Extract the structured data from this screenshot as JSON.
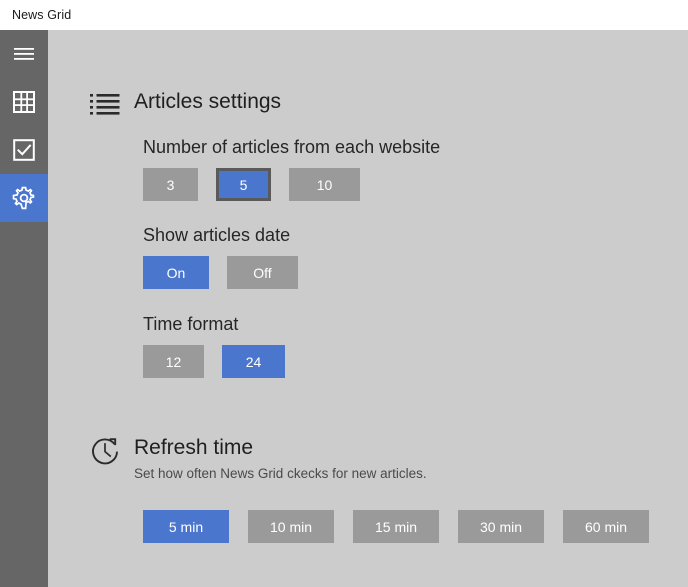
{
  "window": {
    "title": "News Grid"
  },
  "sidebar": {
    "items": [
      {
        "icon": "hamburger-menu-icon",
        "name": "menu",
        "selected": false
      },
      {
        "icon": "grid-icon",
        "name": "grid",
        "selected": false
      },
      {
        "icon": "checkbox-check-icon",
        "name": "tasks",
        "selected": false
      },
      {
        "icon": "gear-icon",
        "name": "settings",
        "selected": true
      }
    ]
  },
  "articles_settings": {
    "icon": "list-icon",
    "title": "Articles settings",
    "number_of_articles": {
      "label": "Number of articles from each website",
      "options": [
        "3",
        "5",
        "10"
      ],
      "selected": "5",
      "focused": "5"
    },
    "show_articles_date": {
      "label": "Show articles date",
      "options": [
        "On",
        "Off"
      ],
      "selected": "On"
    },
    "time_format": {
      "label": "Time format",
      "options": [
        "12",
        "24"
      ],
      "selected": "24"
    }
  },
  "refresh_time": {
    "icon": "clock-refresh-icon",
    "title": "Refresh time",
    "subtitle": "Set how often News Grid ckecks for new articles.",
    "options": [
      "5 min",
      "10 min",
      "15 min",
      "30 min",
      "60 min"
    ],
    "selected": "5 min"
  },
  "colors": {
    "accent": "#4a76ce",
    "button_idle": "#9a9a9a",
    "sidebar": "#666666",
    "content_bg": "#cccccc",
    "titlebar_bg": "#ffffff"
  }
}
